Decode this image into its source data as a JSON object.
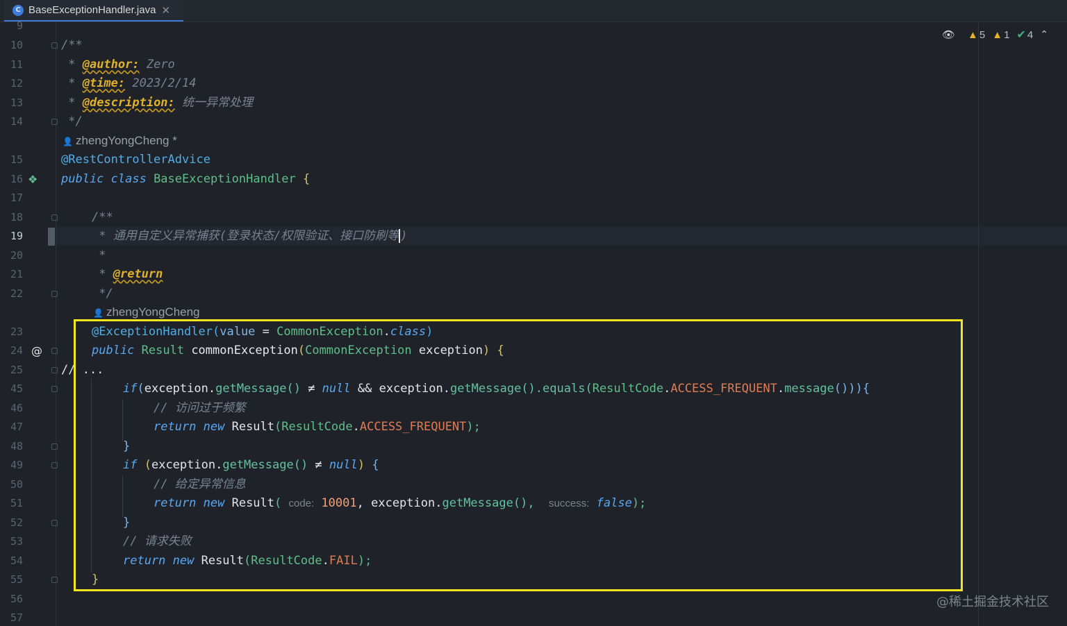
{
  "tab": {
    "title": "BaseExceptionHandler.java",
    "icon": "C",
    "close": "✕"
  },
  "inspections": {
    "warnings": "5",
    "weak_warnings": "1",
    "typos": "4"
  },
  "line_numbers": [
    "9",
    "10",
    "11",
    "12",
    "13",
    "14",
    "15",
    "16",
    "17",
    "18",
    "19",
    "20",
    "21",
    "22",
    "23",
    "24",
    "25",
    "45",
    "46",
    "47",
    "48",
    "49",
    "50",
    "51",
    "52",
    "53",
    "54",
    "55",
    "56",
    "57"
  ],
  "authors": {
    "class_author": "zhengYongCheng *",
    "method_author": "zhengYongCheng"
  },
  "code": {
    "l10": "/**",
    "l11_star": " * ",
    "l11_tag": "@author:",
    "l11_val": " Zero",
    "l12_tag": "@time:",
    "l12_val": " 2023/2/14",
    "l13_tag": "@description:",
    "l13_val": " 统一异常处理",
    "l14": " */",
    "l15": "@RestControllerAdvice",
    "l16_kw": "public class",
    "l16_cls": " BaseExceptionHandler ",
    "l16_brace": "{",
    "l18": "/**",
    "l19_a": " * 通用自定义异常捕获(登录状态/权限验证、接口防刷等",
    "l19_b": ")",
    "l20": " *",
    "l21_star": " * ",
    "l21_tag": "@return",
    "l22": " */",
    "l23_anno": "@ExceptionHandler(",
    "l23_param": "value",
    "l23_eq": " = ",
    "l23_typ": "CommonException",
    "l23_dot": ".",
    "l23_kw": "class",
    "l23_end": ")",
    "l24_kw": "public",
    "l24_typ": " Result ",
    "l24_meth": "commonException",
    "l24_p1": "(",
    "l24_ptype": "CommonException",
    "l24_pname": " exception",
    "l24_p2": ") ",
    "l24_brace": "{",
    "l25": "// ...",
    "l45_kw": "if",
    "l45_a": "(",
    "l45_b": "exception",
    "l45_c": ".",
    "l45_d": "getMessage",
    "l45_e": "() ",
    "l45_ne": "≠",
    "l45_null": " null ",
    "l45_and": "&&",
    "l45_f": " exception",
    "l45_g": ".",
    "l45_h": "getMessage",
    "l45_i": "().",
    "l45_j": "equals",
    "l45_k": "(",
    "l45_l": "ResultCode",
    "l45_m": ".",
    "l45_n": "ACCESS_FREQUENT",
    "l45_o": ".",
    "l45_p": "message",
    "l45_q": "())){",
    "l46": "// 访问过于频繁",
    "l47_kw": "return new",
    "l47_a": " Result",
    "l47_b": "(",
    "l47_c": "ResultCode",
    "l47_d": ".",
    "l47_e": "ACCESS_FREQUENT",
    "l47_f": ");",
    "l48": "}",
    "l49_kw": "if",
    "l49_a": " (",
    "l49_b": "exception",
    "l49_c": ".",
    "l49_d": "getMessage",
    "l49_e": "() ",
    "l49_ne": "≠",
    "l49_null": " null",
    "l49_f": ") ",
    "l49_g": "{",
    "l50": "// 给定异常信息",
    "l51_kw": "return new",
    "l51_a": " Result",
    "l51_b": "( ",
    "l51_hint1": "code:",
    "l51_num": " 10001",
    "l51_c": ", ",
    "l51_d": "exception",
    "l51_e": ".",
    "l51_f": "getMessage",
    "l51_g": "(),  ",
    "l51_hint2": "success:",
    "l51_false": " false",
    "l51_h": ");",
    "l52": "}",
    "l53": "// 请求失败",
    "l54_kw": "return new",
    "l54_a": " Result",
    "l54_b": "(",
    "l54_c": "ResultCode",
    "l54_d": ".",
    "l54_e": "FAIL",
    "l54_f": ");",
    "l55": "}"
  },
  "watermark": "@稀土掘金技术社区",
  "colors": {
    "highlight": "#f3e61b",
    "background": "#1f2329",
    "accent": "#3d7cd9"
  }
}
